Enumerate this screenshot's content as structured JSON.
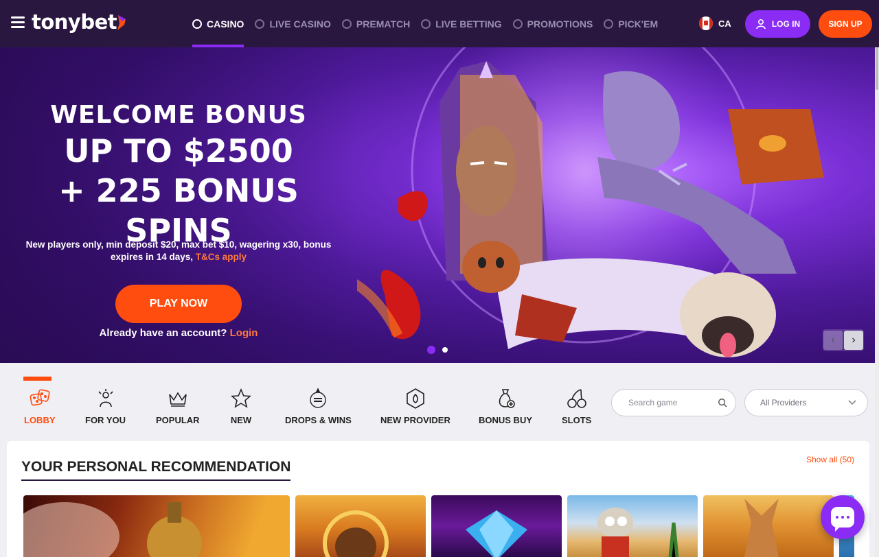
{
  "header": {
    "logo": "tonybet",
    "nav": [
      {
        "label": "CASINO",
        "icon": "casino-chip-icon",
        "active": true
      },
      {
        "label": "LIVE CASINO",
        "icon": "live-casino-icon",
        "active": false
      },
      {
        "label": "PREMATCH",
        "icon": "soccer-ball-icon",
        "active": false
      },
      {
        "label": "LIVE BETTING",
        "icon": "live-betting-icon",
        "active": false
      },
      {
        "label": "PROMOTIONS",
        "icon": "gift-icon",
        "active": false
      },
      {
        "label": "PICK'EM",
        "icon": "pickem-icon",
        "active": false
      }
    ],
    "region": "CA",
    "login_label": "LOG IN",
    "signup_label": "SIGN UP",
    "colors": {
      "header_bg": "#2a1740",
      "accent_purple": "#8b2cf5",
      "accent_orange": "#ff4d0f"
    }
  },
  "hero": {
    "line1": "WELCOME BONUS",
    "line2": "UP TO $2500",
    "line3": "+ 225 BONUS SPINS",
    "terms": "New players only, min deposit $20, max bet $10, wagering x30, bonus expires in 14 days,",
    "terms_link": "T&Cs apply",
    "play_label": "PLAY NOW",
    "account_text": "Already have an account?",
    "login_link": "Login",
    "slides_total": 2,
    "slide_active": 1
  },
  "categories": {
    "items": [
      {
        "label": "LOBBY",
        "icon": "dice-icon",
        "active": true
      },
      {
        "label": "FOR YOU",
        "icon": "for-you-icon",
        "active": false
      },
      {
        "label": "POPULAR",
        "icon": "crown-icon",
        "active": false
      },
      {
        "label": "NEW",
        "icon": "star-icon",
        "active": false
      },
      {
        "label": "DROPS & WINS",
        "icon": "drops-wins-icon",
        "active": false
      },
      {
        "label": "NEW PROVIDER",
        "icon": "new-provider-icon",
        "active": false
      },
      {
        "label": "BONUS BUY",
        "icon": "money-bag-icon",
        "active": false
      },
      {
        "label": "SLOTS",
        "icon": "cherries-icon",
        "active": false
      }
    ],
    "search_placeholder": "Search game",
    "providers_value": "All Providers"
  },
  "recommendations": {
    "title": "YOUR PERSONAL RECOMMENDATION",
    "show_all": "Show all",
    "count": "(50)"
  }
}
